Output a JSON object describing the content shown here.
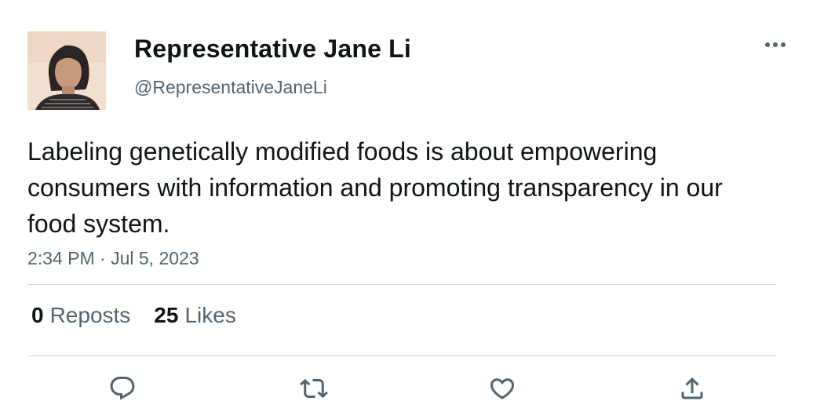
{
  "tweet": {
    "display_name": "Representative Jane Li",
    "handle": "@RepresentativeJaneLi",
    "text": "Labeling genetically modified foods is about empowering consumers with information and promoting transparency in our food system.",
    "timestamp": "2:34 PM · Jul 5, 2023"
  },
  "stats": {
    "reposts_count": "0",
    "reposts_label": "Reposts",
    "likes_count": "25",
    "likes_label": "Likes"
  },
  "icons": {
    "more": "more-horizontal-icon",
    "reply": "reply-icon",
    "repost": "repost-icon",
    "like": "heart-icon",
    "share": "share-icon"
  },
  "colors": {
    "text_primary": "#0f1419",
    "text_secondary": "#536471",
    "divider": "#cfd9de",
    "background": "#ffffff"
  }
}
